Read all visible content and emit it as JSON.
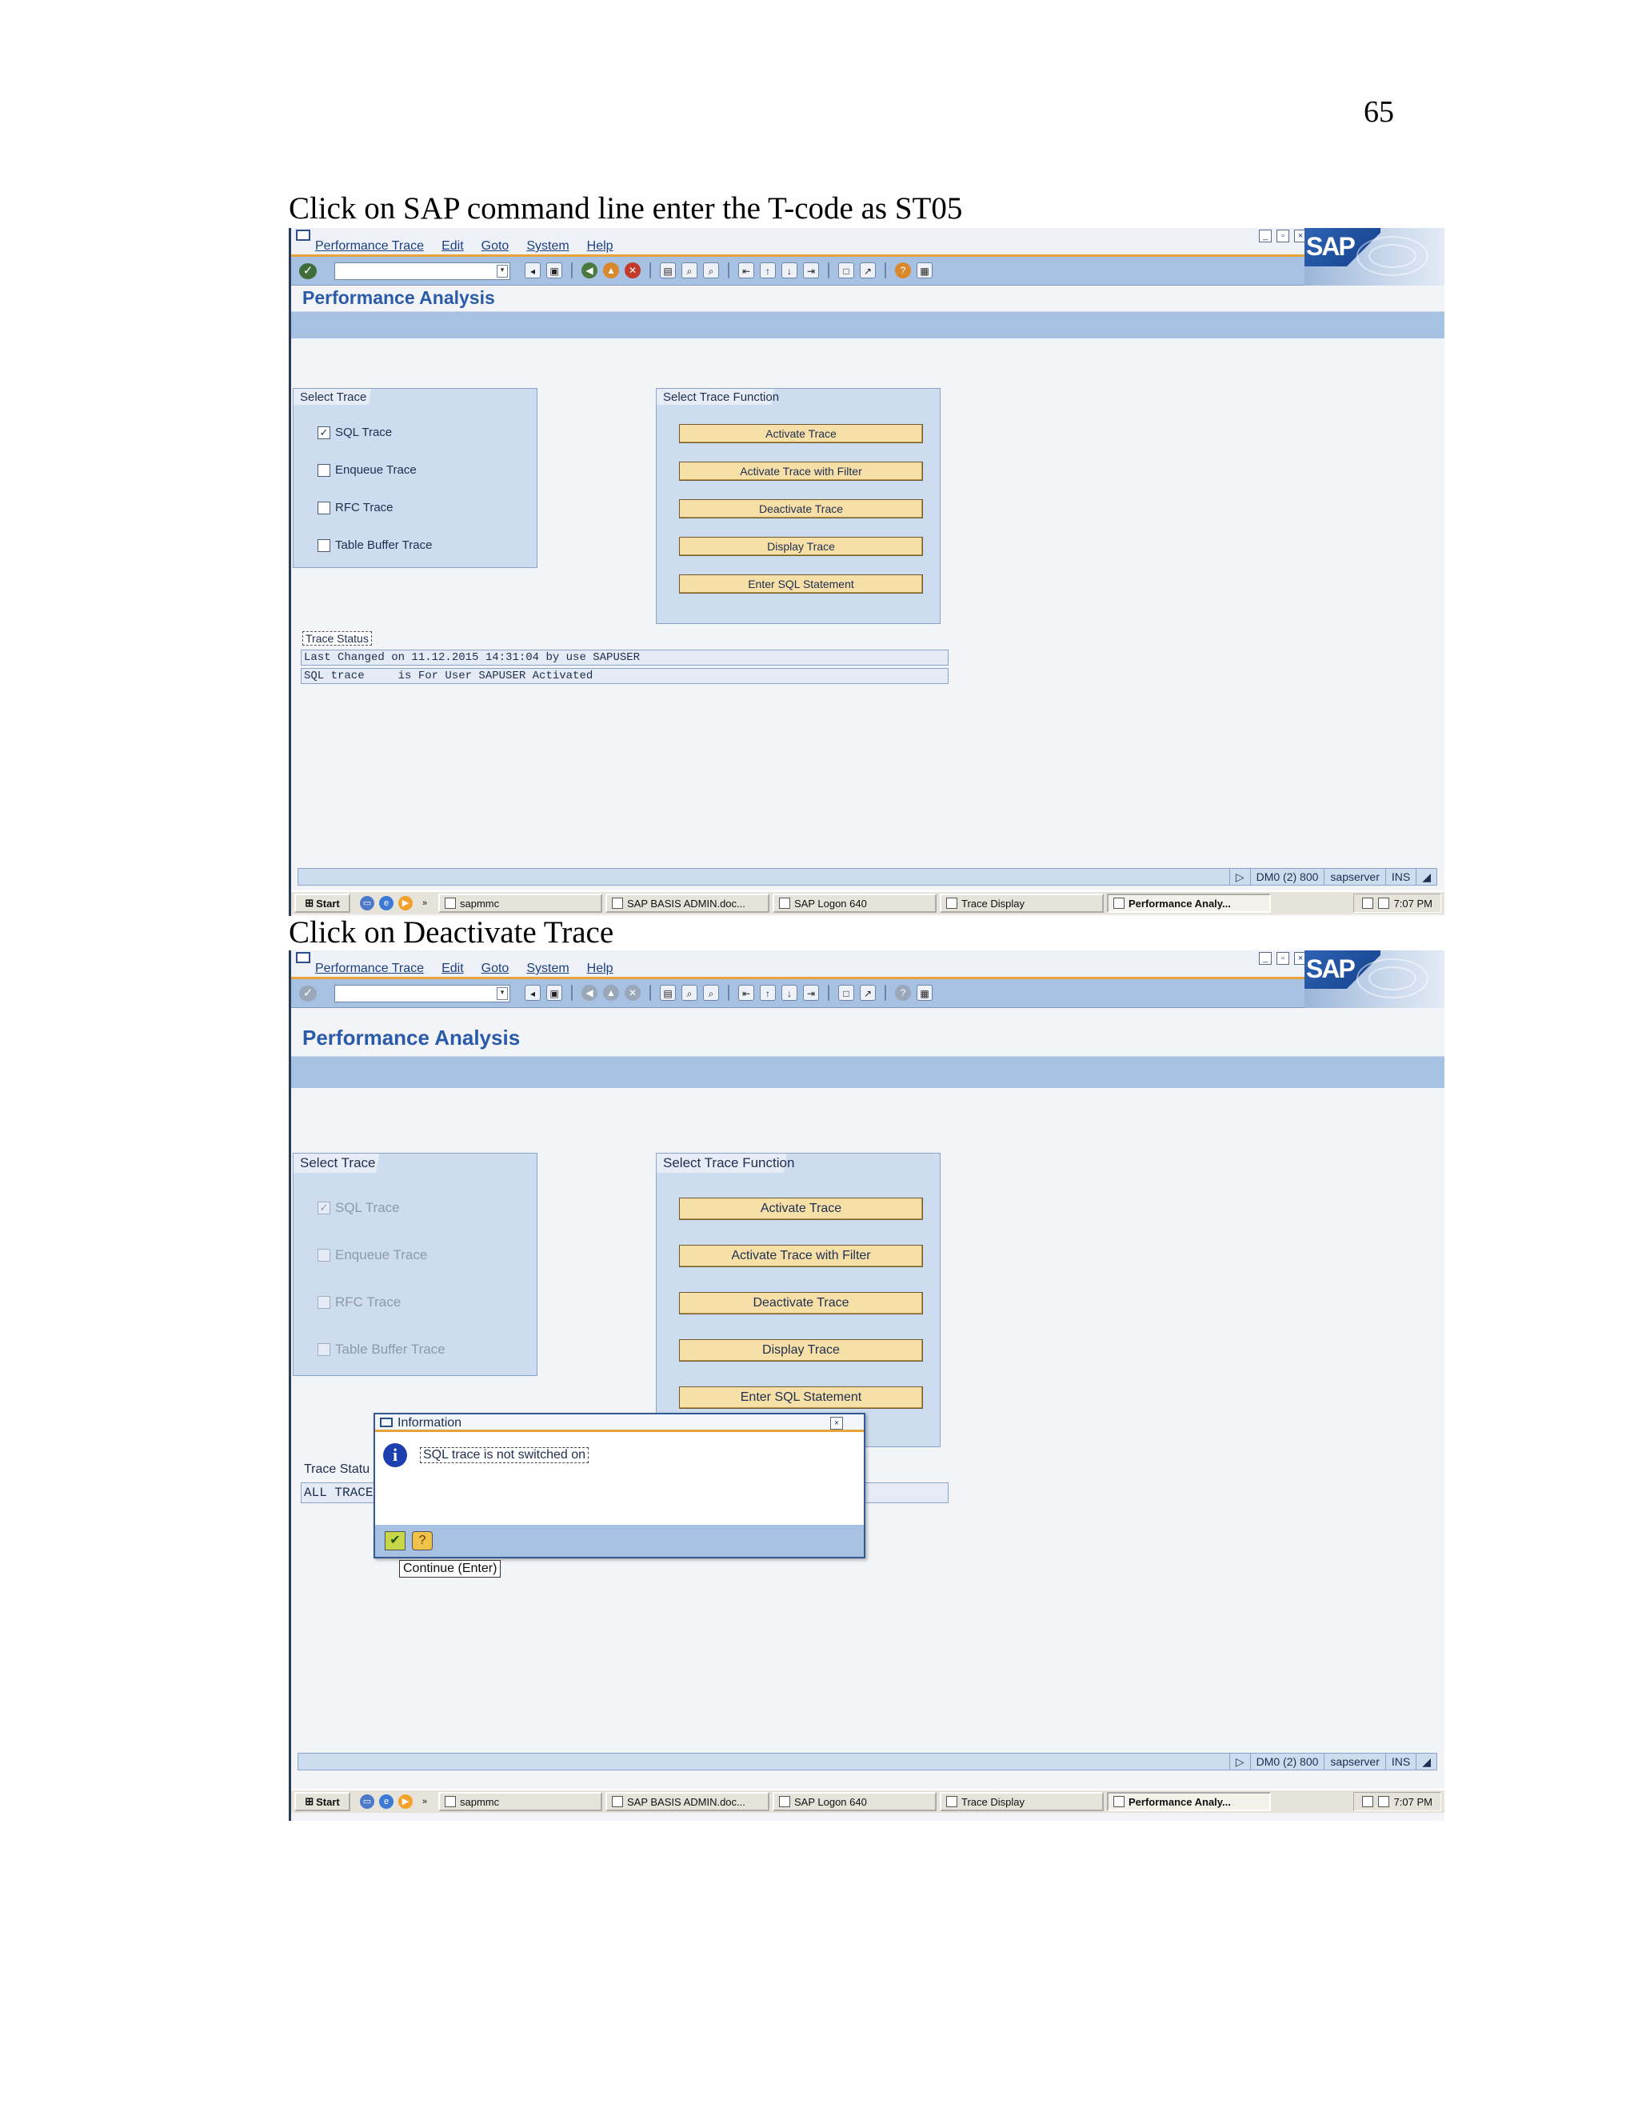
{
  "page_number": "65",
  "captions": {
    "first": "Click on SAP command line enter the T-code as ST05",
    "second": "Click on Deactivate Trace"
  },
  "sap": {
    "menu": [
      "Performance Trace",
      "Edit",
      "Goto",
      "System",
      "Help"
    ],
    "logo": "SAP",
    "title": "Performance Analysis",
    "select_trace_title": "Select Trace",
    "select_trace_function_title": "Select Trace Function",
    "traces": [
      {
        "label": "SQL Trace",
        "checked": true
      },
      {
        "label": "Enqueue Trace",
        "checked": false
      },
      {
        "label": "RFC Trace",
        "checked": false
      },
      {
        "label": "Table Buffer Trace",
        "checked": false
      }
    ],
    "functions": [
      "Activate Trace",
      "Activate Trace with Filter",
      "Deactivate Trace",
      "Display Trace",
      "Enter SQL Statement"
    ],
    "status_bar": {
      "system": "DM0 (2) 800",
      "server": "sapserver",
      "mode": "INS"
    }
  },
  "screen1": {
    "trace_status_label": "Trace Status",
    "status_lines": [
      "Last Changed on 11.12.2015 14:31:04 by use SAPUSER",
      "SQL trace     is For User SAPUSER Activated"
    ]
  },
  "screen2": {
    "trace_status_label": "Trace Statu",
    "status_line": "ALL TRACE",
    "dialog": {
      "title": "Information",
      "message": "SQL trace is not switched on",
      "tooltip": "Continue   (Enter)"
    }
  },
  "taskbar": {
    "start": "Start",
    "chevron": "»",
    "tasks": [
      "sapmmc",
      "SAP BASIS ADMIN.doc...",
      "SAP Logon 640",
      "Trace Display",
      "Performance Analy..."
    ],
    "time": "7:07 PM"
  }
}
